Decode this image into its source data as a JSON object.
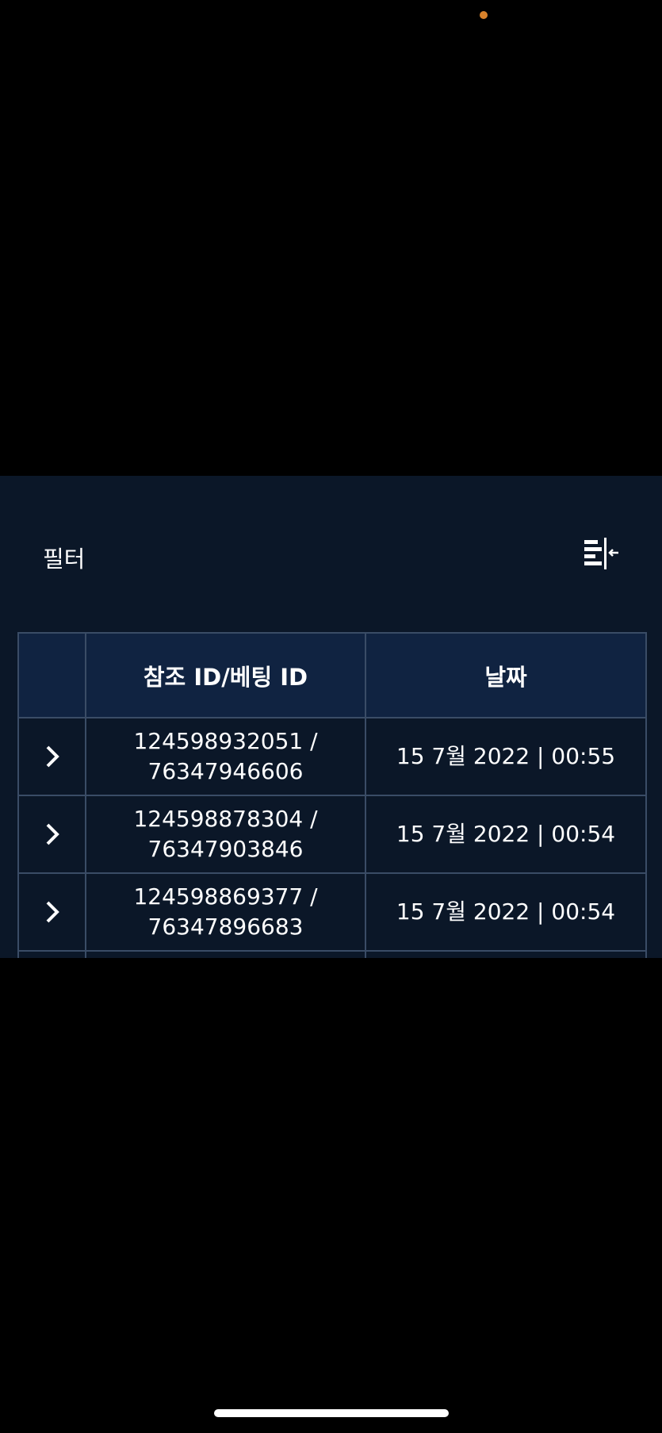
{
  "colors": {
    "status_dot": "#d9822b",
    "panel_background": "#0b1728",
    "header_background": "#102341",
    "grid_line": "#3a4c66",
    "text": "#ffffff"
  },
  "toolbar": {
    "filter_label": "필터",
    "collapse_icon": "collapse-columns-icon"
  },
  "table": {
    "columns": [
      "",
      "참조 ID/베팅 ID",
      "날짜"
    ],
    "rows": [
      {
        "ref_id": "124598932051 /",
        "bet_id": "76347946606",
        "date": "15 7월 2022 | 00:55"
      },
      {
        "ref_id": "124598878304 /",
        "bet_id": "76347903846",
        "date": "15 7월 2022 | 00:54"
      },
      {
        "ref_id": "124598869377 /",
        "bet_id": "76347896683",
        "date": "15 7월 2022 | 00:54"
      },
      {
        "ref_id": "",
        "bet_id": "",
        "date": ""
      }
    ]
  }
}
